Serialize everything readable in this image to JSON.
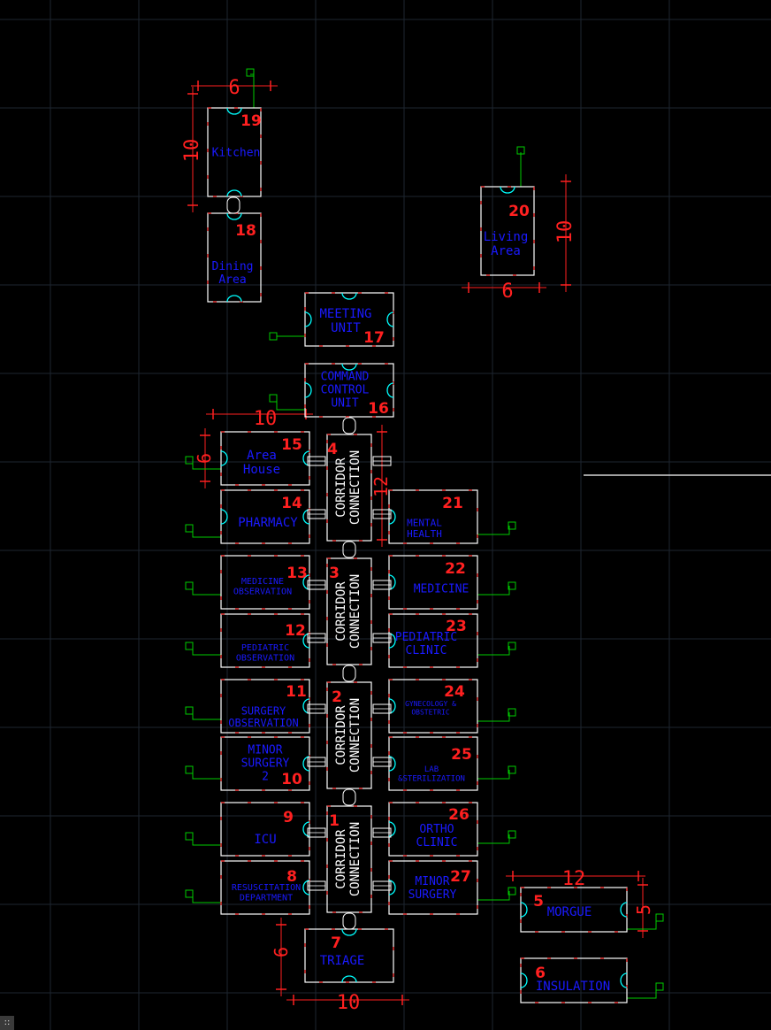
{
  "colors": {
    "background": "#000000",
    "grid": "#1e2630",
    "wall": "#ffffff",
    "dash": "#ff2a2a",
    "door": "#00ffff",
    "dimension": "#ff2020",
    "label": "#1a1aff",
    "number": "#ff2020",
    "utility": "#00cc00"
  },
  "rooms": [
    {
      "id": "room-19",
      "number": "19",
      "lines": [
        "Kitchen"
      ]
    },
    {
      "id": "room-18",
      "number": "18",
      "lines": [
        "Dining",
        "Area"
      ]
    },
    {
      "id": "room-20",
      "number": "20",
      "lines": [
        "Living",
        "Area"
      ]
    },
    {
      "id": "room-17",
      "number": "17",
      "lines": [
        "MEETING",
        "UNIT"
      ]
    },
    {
      "id": "room-16",
      "number": "16",
      "lines": [
        "COMMAND",
        "CONTROL",
        "UNIT"
      ]
    },
    {
      "id": "room-15",
      "number": "15",
      "lines": [
        "Area",
        "House"
      ]
    },
    {
      "id": "room-14",
      "number": "14",
      "lines": [
        "PHARMACY"
      ]
    },
    {
      "id": "room-13",
      "number": "13",
      "lines": [
        "MEDICINE",
        "OBSERVATION"
      ]
    },
    {
      "id": "room-12",
      "number": "12",
      "lines": [
        "PEDIATRIC",
        "OBSERVATION"
      ]
    },
    {
      "id": "room-11",
      "number": "11",
      "lines": [
        "SURGERY",
        "OBSERVATION"
      ]
    },
    {
      "id": "room-10",
      "number": "10",
      "lines": [
        "MINOR",
        "SURGERY",
        "2"
      ]
    },
    {
      "id": "room-9",
      "number": "9",
      "lines": [
        "ICU"
      ]
    },
    {
      "id": "room-8",
      "number": "8",
      "lines": [
        "RESUSCITATION",
        "DEPARTMENT"
      ]
    },
    {
      "id": "room-7",
      "number": "7",
      "lines": [
        "TRIAGE"
      ]
    },
    {
      "id": "room-21",
      "number": "21",
      "lines": [
        "MENTAL",
        "HEALTH"
      ]
    },
    {
      "id": "room-22",
      "number": "22",
      "lines": [
        "MEDICINE"
      ]
    },
    {
      "id": "room-23",
      "number": "23",
      "lines": [
        "PEDIATRIC",
        "CLINIC"
      ]
    },
    {
      "id": "room-24",
      "number": "24",
      "lines": [
        "GYNECOLOGY &",
        "OBSTETRIC"
      ]
    },
    {
      "id": "room-25",
      "number": "25",
      "lines": [
        "LAB",
        "&STERILIZATION"
      ]
    },
    {
      "id": "room-26",
      "number": "26",
      "lines": [
        "ORTHO",
        "CLINIC"
      ]
    },
    {
      "id": "room-27",
      "number": "27",
      "lines": [
        "MINOR",
        "SURGERY"
      ]
    },
    {
      "id": "room-5",
      "number": "5",
      "lines": [
        "MORGUE"
      ]
    },
    {
      "id": "room-6",
      "number": "6",
      "lines": [
        "INSULATION"
      ]
    }
  ],
  "corridors": [
    {
      "id": "corridor-4",
      "number": "4",
      "lines": [
        "CORRIDOR",
        "CONNECTION"
      ]
    },
    {
      "id": "corridor-3",
      "number": "3",
      "lines": [
        "CORRIDOR",
        "CONNECTION"
      ]
    },
    {
      "id": "corridor-2",
      "number": "2",
      "lines": [
        "CORRIDOR",
        "CONNECTION"
      ]
    },
    {
      "id": "corridor-1",
      "number": "1",
      "lines": [
        "CORRIDOR",
        "CONNECTION"
      ]
    }
  ],
  "dimensions": [
    {
      "id": "dim-kitchen-width",
      "value": "6"
    },
    {
      "id": "dim-kitchen-height",
      "value": "10"
    },
    {
      "id": "dim-living-height",
      "value": "10"
    },
    {
      "id": "dim-living-width",
      "value": "6"
    },
    {
      "id": "dim-area-width",
      "value": "10"
    },
    {
      "id": "dim-area-height",
      "value": "6"
    },
    {
      "id": "dim-corridor-height",
      "value": "12"
    },
    {
      "id": "dim-morgue-width",
      "value": "12"
    },
    {
      "id": "dim-morgue-height",
      "value": "5"
    },
    {
      "id": "dim-triage-height",
      "value": "6"
    },
    {
      "id": "dim-triage-width",
      "value": "10"
    }
  ],
  "status_badge": "::"
}
